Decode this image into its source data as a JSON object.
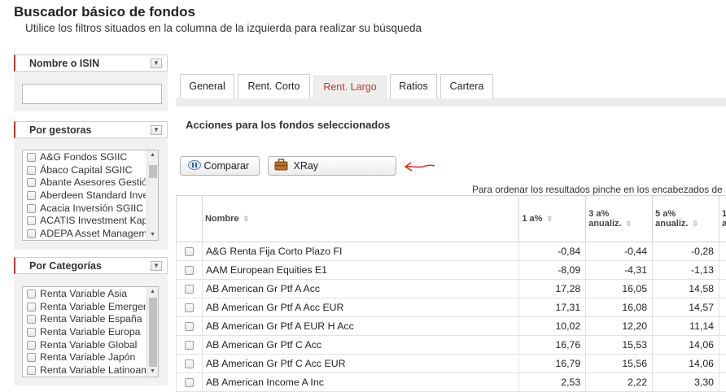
{
  "page": {
    "title": "Buscador básico de fondos",
    "subtitle": "Utilice los filtros situados en la columna de la izquierda para realizar su búsqueda"
  },
  "filters": {
    "name_isin": {
      "label": "Nombre o ISIN",
      "value": ""
    },
    "gestoras": {
      "label": "Por gestoras",
      "items": [
        "A&G Fondos SGIIC",
        "Ábaco Capital SGIIC",
        "Abante Asesores Gestió",
        "Aberdeen Standard Inve",
        "Acacia Inversión SGIIC",
        "ACATIS Investment Kap",
        "ADEPA Asset Managem"
      ]
    },
    "categorias": {
      "label": "Por Categorías",
      "items": [
        "Renta Variable Asia",
        "Renta Variable Emergen",
        "Renta Variable España",
        "Renta Variable Europa",
        "Renta Variable Global",
        "Renta Variable Japón",
        "Renta Variable Latinoam"
      ]
    }
  },
  "tabs": [
    "General",
    "Rent. Corto",
    "Rent. Largo",
    "Ratios",
    "Cartera"
  ],
  "active_tab": "Rent. Largo",
  "section_title": "Acciones para los fondos seleccionados",
  "buttons": {
    "compare": "Comparar",
    "xray": "XRay"
  },
  "sort_hint": "Para ordenar los resultados pinche en los encabezados de",
  "table": {
    "headers": {
      "name": "Nombre",
      "y1": "1 a%",
      "y3_line1": "3 a%",
      "y3_line2": "anualiz.",
      "y5_line1": "5 a%",
      "y5_line2": "anualiz.",
      "extra_line1": "1",
      "extra_line2": "a"
    },
    "rows": [
      {
        "name": "A&G Renta Fija Corto Plazo FI",
        "y1": "-0,84",
        "y3": "-0,44",
        "y5": "-0,28"
      },
      {
        "name": "AAM European Equities E1",
        "y1": "-8,09",
        "y3": "-4,31",
        "y5": "-1,13"
      },
      {
        "name": "AB American Gr Ptf A Acc",
        "y1": "17,28",
        "y3": "16,05",
        "y5": "14,58"
      },
      {
        "name": "AB American Gr Ptf A Acc EUR",
        "y1": "17,31",
        "y3": "16,08",
        "y5": "14,57"
      },
      {
        "name": "AB American Gr Ptf A EUR H Acc",
        "y1": "10,02",
        "y3": "12,20",
        "y5": "11,14"
      },
      {
        "name": "AB American Gr Ptf C Acc",
        "y1": "16,76",
        "y3": "15,53",
        "y5": "14,06"
      },
      {
        "name": "AB American Gr Ptf C Acc EUR",
        "y1": "16,79",
        "y3": "15,56",
        "y5": "14,06"
      },
      {
        "name": "AB American Income A Inc",
        "y1": "2,53",
        "y3": "2,22",
        "y5": "3,30"
      }
    ]
  },
  "colors": {
    "accent": "#c0392b",
    "arrow": "#e02020"
  }
}
